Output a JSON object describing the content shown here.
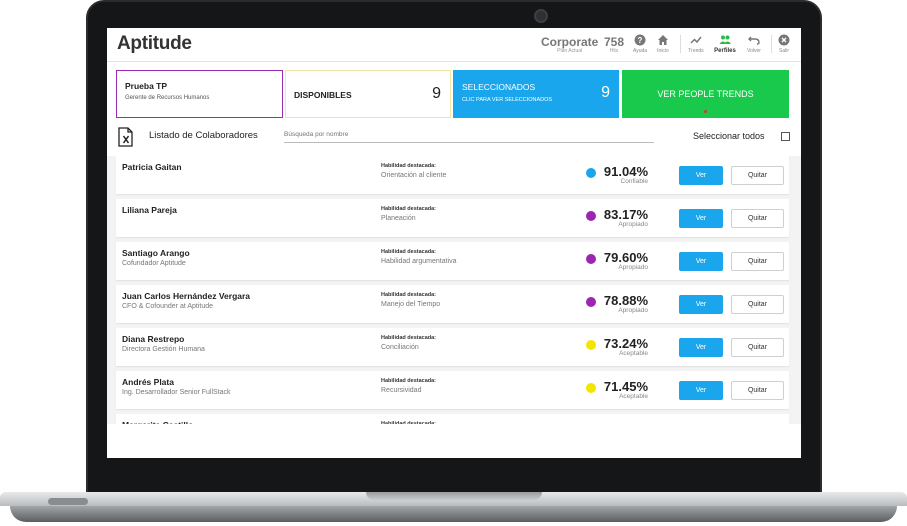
{
  "app": {
    "logo_text": "Aptitude",
    "plan_name": "Corporate",
    "plan_sub": "Plan Actual",
    "hits_value": "758",
    "hits_sub": "Hits"
  },
  "nav": [
    {
      "label": "Ayuda",
      "icon": "help-icon"
    },
    {
      "label": "Inicio",
      "icon": "home-icon"
    },
    {
      "label": "Trends",
      "icon": "trend-icon"
    },
    {
      "label": "Perfiles",
      "icon": "people-icon"
    },
    {
      "label": "Volver",
      "icon": "undo-icon"
    },
    {
      "label": "Salir",
      "icon": "close-circle-icon"
    }
  ],
  "cards": {
    "profile_title": "Prueba TP",
    "profile_sub": "Gerente de Recursos Humanos",
    "disponibles_label": "DISPONIBLES",
    "disponibles_count": "9",
    "seleccionados_label": "SELECCIONADOS",
    "seleccionados_sub": "CLIC PARA VER SELECCIONADOS",
    "seleccionados_count": "9",
    "trends_label": "VER PEOPLE TRENDS"
  },
  "list": {
    "title": "Listado de Colaboradores",
    "search_placeholder": "Búsqueda por nombre",
    "select_all": "Seleccionar todos"
  },
  "colors": {
    "blue": "#1aa6ec",
    "purple": "#9b27b0",
    "yellow": "#f2e600",
    "green": "#19c94b"
  },
  "rows": [
    {
      "name": "Patricia Gaitan",
      "role": "",
      "skill_label": "Habilidad destacada:",
      "skill": "Orientación al cliente",
      "pct": "91.04%",
      "level": "Confiable",
      "dot": "#1aa6ec",
      "ver": "Ver",
      "quitar": "Quitar"
    },
    {
      "name": "Liliana Pareja",
      "role": "",
      "skill_label": "Habilidad destacada:",
      "skill": "Planeación",
      "pct": "83.17%",
      "level": "Apropiado",
      "dot": "#9b27b0",
      "ver": "Ver",
      "quitar": "Quitar"
    },
    {
      "name": "Santiago Arango",
      "role": "Cofundador Aptitude",
      "skill_label": "Habilidad destacada:",
      "skill": "Habilidad argumentativa",
      "pct": "79.60%",
      "level": "Apropiado",
      "dot": "#9b27b0",
      "ver": "Ver",
      "quitar": "Quitar"
    },
    {
      "name": "Juan Carlos Hernández Vergara",
      "role": "CFO & Cofounder at Aptitude",
      "skill_label": "Habilidad destacada:",
      "skill": "Manejo del Tiempo",
      "pct": "78.88%",
      "level": "Apropiado",
      "dot": "#9b27b0",
      "ver": "Ver",
      "quitar": "Quitar"
    },
    {
      "name": "Diana Restrepo",
      "role": "Directora Gestión Humana",
      "skill_label": "Habilidad destacada:",
      "skill": "Conciliación",
      "pct": "73.24%",
      "level": "Aceptable",
      "dot": "#f2e600",
      "ver": "Ver",
      "quitar": "Quitar"
    },
    {
      "name": "Andrés Plata",
      "role": "Ing. Desarrollador Senior FullStack",
      "skill_label": "Habilidad destacada:",
      "skill": "Recursividad",
      "pct": "71.45%",
      "level": "Aceptable",
      "dot": "#f2e600",
      "ver": "Ver",
      "quitar": "Quitar"
    },
    {
      "name": "Margarita Castillo",
      "role": "",
      "skill_label": "Habilidad destacada:",
      "skill": "",
      "pct": "",
      "level": "",
      "dot": "",
      "ver": "",
      "quitar": ""
    }
  ]
}
